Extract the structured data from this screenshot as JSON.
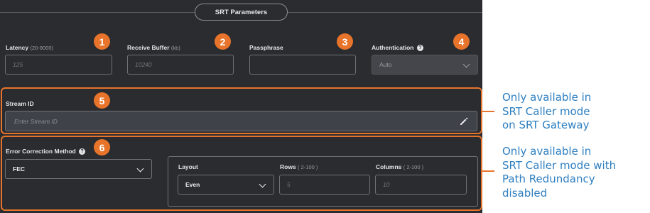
{
  "section": {
    "title": "SRT Parameters"
  },
  "latency": {
    "label": "Latency",
    "hint": "(20-8000)",
    "placeholder": "125",
    "badge": "1"
  },
  "receive_buffer": {
    "label": "Receive Buffer",
    "hint": "(kb)",
    "placeholder": "10240",
    "badge": "2"
  },
  "passphrase": {
    "label": "Passphrase",
    "value": "",
    "badge": "3"
  },
  "authentication": {
    "label": "Authentication",
    "value": "Auto",
    "badge": "4",
    "icon": "help-icon"
  },
  "stream_id": {
    "label": "Stream ID",
    "placeholder": "Enter Stream ID",
    "badge": "5",
    "icon": "pencil-icon"
  },
  "error_correction": {
    "label": "Error Correction Method",
    "value": "FEC",
    "badge": "6",
    "icon": "help-icon"
  },
  "layout": {
    "label": "Layout",
    "value": "Even"
  },
  "rows": {
    "label": "Rows",
    "hint": "( 2-100 )",
    "placeholder": "5"
  },
  "columns": {
    "label": "Columns",
    "hint": "( 2-100 )",
    "placeholder": "10"
  },
  "notes": {
    "stream_id_note": "Only available in\nSRT Caller mode\non SRT Gateway",
    "error_correction_note": "Only available in\nSRT Caller mode with\nPath Redundancy\ndisabled"
  },
  "colors": {
    "panel": "#2b2c30",
    "accent": "#e8742b",
    "note_text": "#2e7fc1"
  }
}
